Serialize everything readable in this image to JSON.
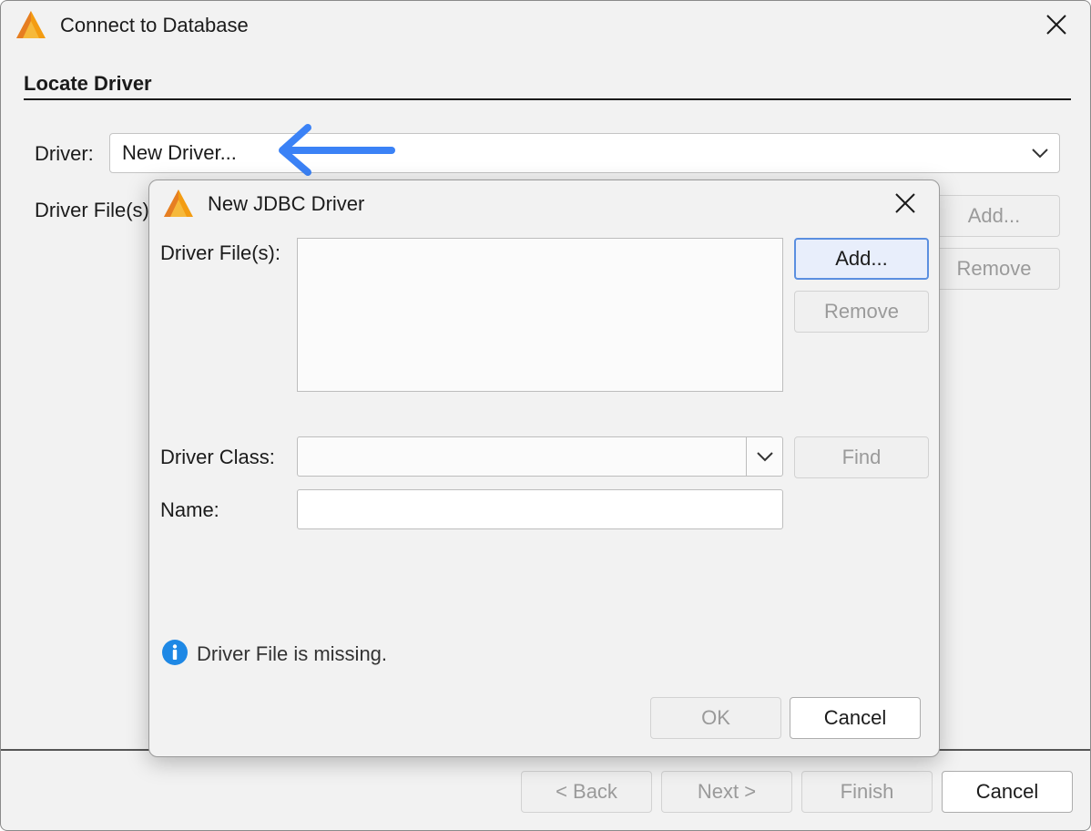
{
  "main": {
    "title": "Connect to Database",
    "section": "Locate Driver",
    "driver_label": "Driver:",
    "driver_value": "New Driver...",
    "driver_files_label": "Driver File(s):",
    "add_label": "Add...",
    "remove_label": "Remove",
    "back_label": "< Back",
    "next_label": "Next >",
    "finish_label": "Finish",
    "cancel_label": "Cancel"
  },
  "dialog": {
    "title": "New JDBC Driver",
    "driver_files_label": "Driver File(s):",
    "add_label": "Add...",
    "remove_label": "Remove",
    "driver_class_label": "Driver Class:",
    "driver_class_value": "",
    "find_label": "Find",
    "name_label": "Name:",
    "name_value": "",
    "info_text": "Driver File is missing.",
    "ok_label": "OK",
    "cancel_label": "Cancel"
  },
  "colors": {
    "arrow": "#3b82f6",
    "focus_border": "#5b8fe0",
    "info_icon": "#1e88e5"
  },
  "icons": [
    "app-logo-icon",
    "close-icon",
    "chevron-down-icon",
    "info-icon",
    "arrow-left-icon"
  ]
}
